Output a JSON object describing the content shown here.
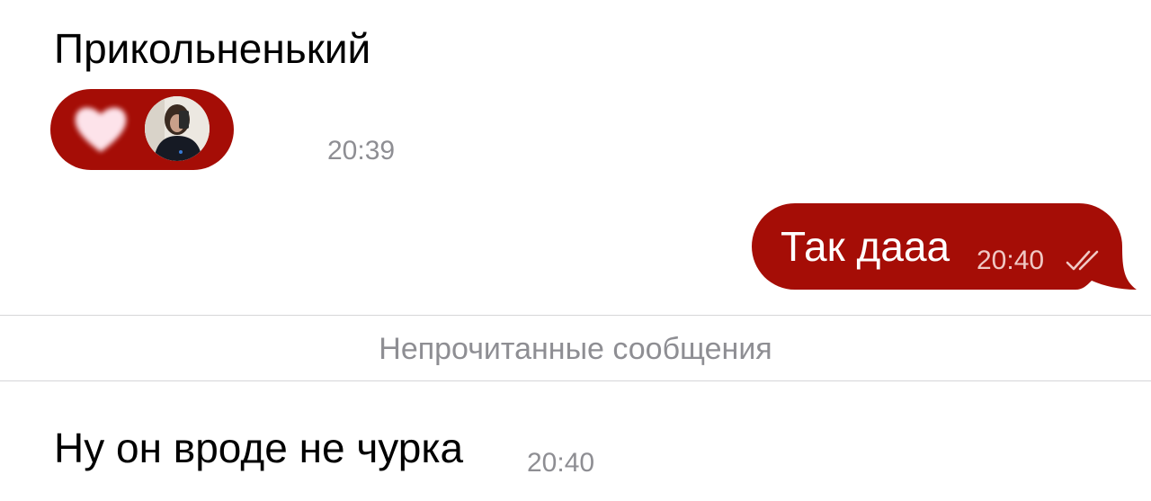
{
  "messages": {
    "incoming_1": {
      "text": "Прикольненький"
    },
    "reaction": {
      "emoji": "heart-icon",
      "reaction_color": "#a50d06",
      "time": "20:39"
    },
    "outgoing_1": {
      "text": "Так дааа",
      "time": "20:40",
      "status": "read",
      "bubble_color": "#a50d06"
    },
    "unread_separator": {
      "label": "Непрочитанные сообщения"
    },
    "incoming_2": {
      "text": "Ну он вроде не чурка",
      "time": "20:40"
    }
  }
}
